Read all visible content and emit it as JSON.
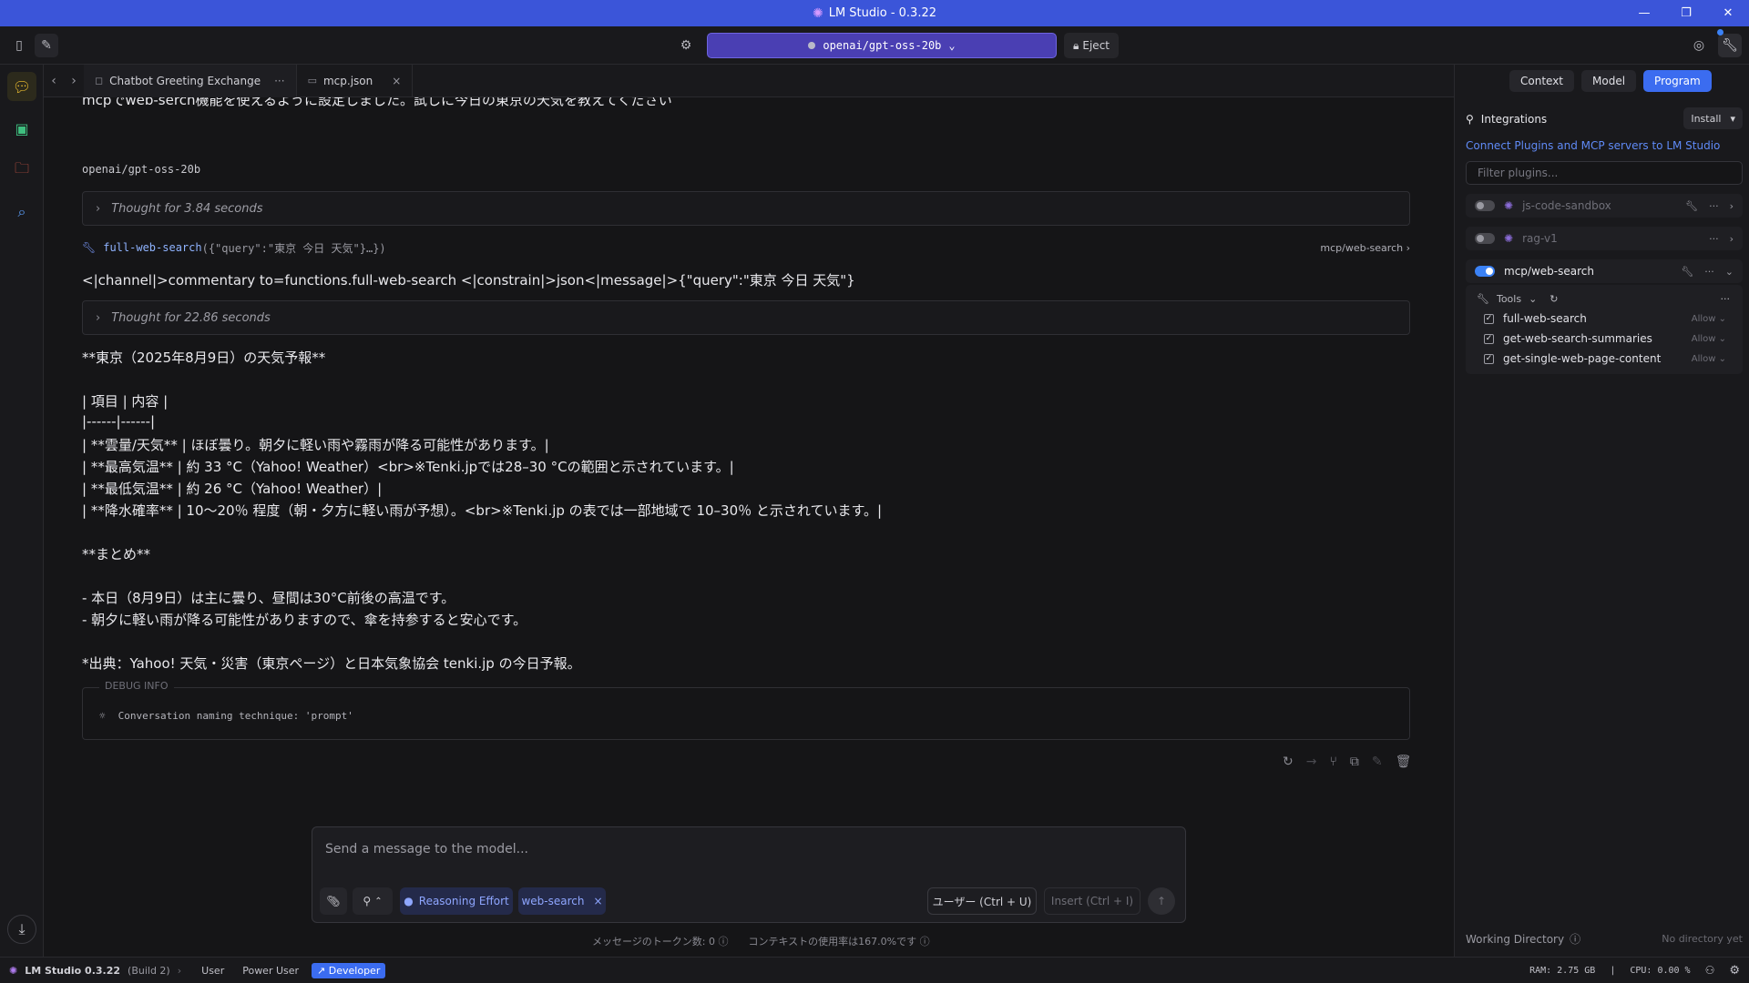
{
  "window": {
    "title": "LM Studio - 0.3.22",
    "logo_icon": "lmstudio-logo-icon"
  },
  "toolbar": {
    "model": "openai/gpt-oss-20b",
    "eject_label": "Eject"
  },
  "tabs": [
    {
      "label": "Chatbot Greeting Exchange",
      "more": "···"
    },
    {
      "label": "mcp.json",
      "close": "×"
    }
  ],
  "chat": {
    "user_message": "mcpでweb-serch機能を使えるように設定しました。試しに今日の東京の天気を教えてください",
    "model_label": "openai/gpt-oss-20b",
    "thought1": "Thought for 3.84 seconds",
    "toolcall": {
      "name": "full-web-search",
      "args": "({\"query\":\"東京 今日 天気\"}…})",
      "source": "mcp/web-search"
    },
    "channel_line": "<|channel|>commentary to=functions.full-web-search <|constrain|>json<|message|>{\"query\":\"東京 今日 天気\"}",
    "thought2": "Thought for 22.86 seconds",
    "lines": [
      "**東京（2025年8月9日）の天気予報**",
      "| 項目 | 内容 |",
      "|------|------|",
      "| **雲量/天気** | ほぼ曇り。朝夕に軽い雨や霧雨が降る可能性があります。|",
      "| **最高気温** | 約 33 °C（Yahoo! Weather）<br>※Tenki.jpでは28–30 °Cの範囲と示されています。|",
      "| **最低気温** | 約 26 °C（Yahoo! Weather）|",
      "| **降水確率** | 10〜20％ 程度（朝・夕方に軽い雨が予想）。<br>※Tenki.jp の表では一部地域で 10–30％ と示されています。|",
      "**まとめ**",
      "- 本日（8月9日）は主に曇り、昼間は30°C前後の高温です。",
      "- 朝夕に軽い雨が降る可能性がありますので、傘を持参すると安心です。",
      "*出典：Yahoo! 天気・災害（東京ページ）と日本気象協会 tenki.jp の今日予報。"
    ],
    "debug_legend": "DEBUG INFO",
    "debug_text": "Conversation naming technique: 'prompt'"
  },
  "composer": {
    "placeholder": "Send a message to the model...",
    "reasoning_label": "Reasoning Effort",
    "chip_label": "web-search",
    "user_button": "ユーザー (Ctrl + U)",
    "insert_button": "Insert (Ctrl + I)",
    "tokens_label": "メッセージのトークン数:  0",
    "context_label": "コンテキストの使用率は167.0%です"
  },
  "right": {
    "tabs": [
      "Context",
      "Model",
      "Program"
    ],
    "integrations_title": "Integrations",
    "install_label": "Install",
    "description": "Connect Plugins and MCP servers to LM Studio",
    "filter_placeholder": "Filter plugins...",
    "plugins": [
      {
        "name": "js-code-sandbox",
        "enabled": false
      },
      {
        "name": "rag-v1",
        "enabled": false
      },
      {
        "name": "mcp/web-search",
        "enabled": true
      }
    ],
    "tools_label": "Tools",
    "tools": [
      {
        "name": "full-web-search",
        "permission": "Allow"
      },
      {
        "name": "get-web-search-summaries",
        "permission": "Allow"
      },
      {
        "name": "get-single-web-page-content",
        "permission": "Allow"
      }
    ],
    "working_directory_label": "Working Directory",
    "no_directory": "No directory yet"
  },
  "status": {
    "app_label": "LM Studio 0.3.22",
    "build": "(Build 2)",
    "modes": [
      "User",
      "Power User",
      "Developer"
    ],
    "ram": "RAM: 2.75 GB",
    "cpu": "CPU: 0.00 %"
  },
  "colors": {
    "accent": "#3b55d9",
    "primary_button": "#3b6cf0",
    "model_picker": "#4a3fb3",
    "active_nav": "#f2c230"
  }
}
